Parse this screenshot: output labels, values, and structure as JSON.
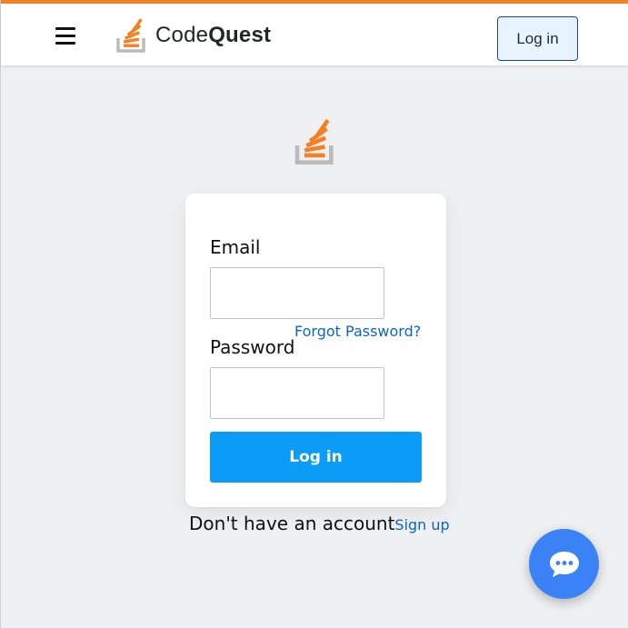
{
  "colors": {
    "accent_bar": "#f48024",
    "primary_button": "#0a9cf6",
    "link": "#0a66c2",
    "chat_fab": "#3b82f6",
    "page_background": "#eff0f2"
  },
  "header": {
    "menu_icon": "hamburger-icon",
    "brand_icon": "stack-logo-icon",
    "brand_name_part1": "Code",
    "brand_name_part2": "Quest",
    "login_label": "Log in"
  },
  "login_form": {
    "logo_icon": "stack-logo-icon",
    "email_label": "Email",
    "email_value": "",
    "forgot_password_label": "Forgot Password?",
    "password_label": "Password",
    "password_value": "",
    "submit_label": "Log in"
  },
  "footer": {
    "no_account_text": "Don't have an account",
    "signup_label": "Sign up"
  },
  "chat": {
    "icon": "chat-bubble-icon"
  }
}
